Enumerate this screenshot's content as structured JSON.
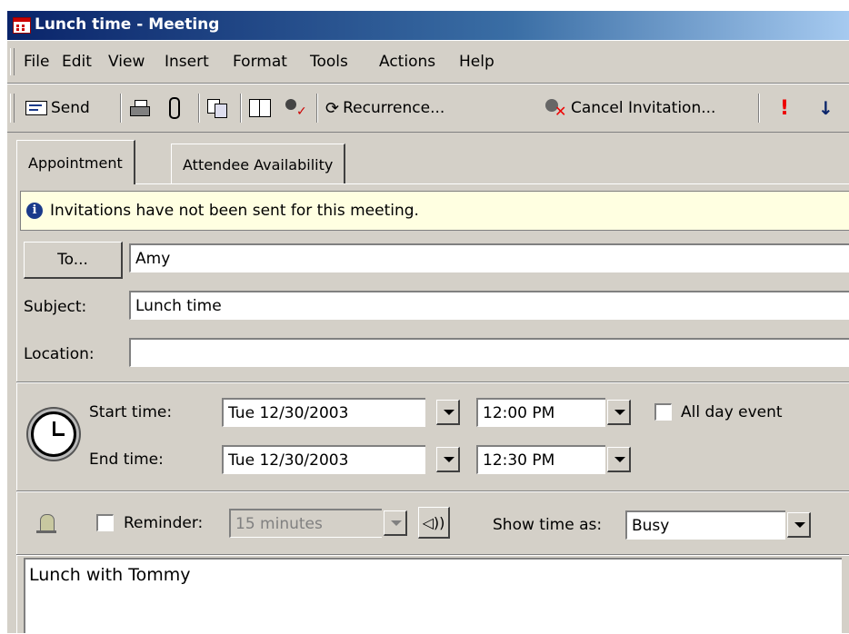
{
  "window": {
    "title": "Lunch time - Meeting"
  },
  "menu": [
    "File",
    "Edit",
    "View",
    "Insert",
    "Format",
    "Tools",
    "Actions",
    "Help"
  ],
  "toolbar": {
    "send": "Send",
    "recurrence": "Recurrence...",
    "cancel_invitation": "Cancel Invitation..."
  },
  "tabs": [
    "Appointment",
    "Attendee Availability"
  ],
  "info": {
    "message": "Invitations have not been sent for this meeting."
  },
  "form": {
    "to_button": "To...",
    "to_value": "Amy",
    "subject_label": "Subject:",
    "subject_value": "Lunch time",
    "location_label": "Location:",
    "location_value": ""
  },
  "time": {
    "start_label": "Start time:",
    "start_date": "Tue 12/30/2003",
    "start_time": "12:00 PM",
    "all_day_label": "All day event",
    "all_day_checked": false,
    "end_label": "End time:",
    "end_date": "Tue 12/30/2003",
    "end_time": "12:30 PM"
  },
  "reminder": {
    "label": "Reminder:",
    "checked": false,
    "value": "15 minutes",
    "show_time_label": "Show time as:",
    "show_time_value": "Busy"
  },
  "notes": "Lunch with Tommy"
}
